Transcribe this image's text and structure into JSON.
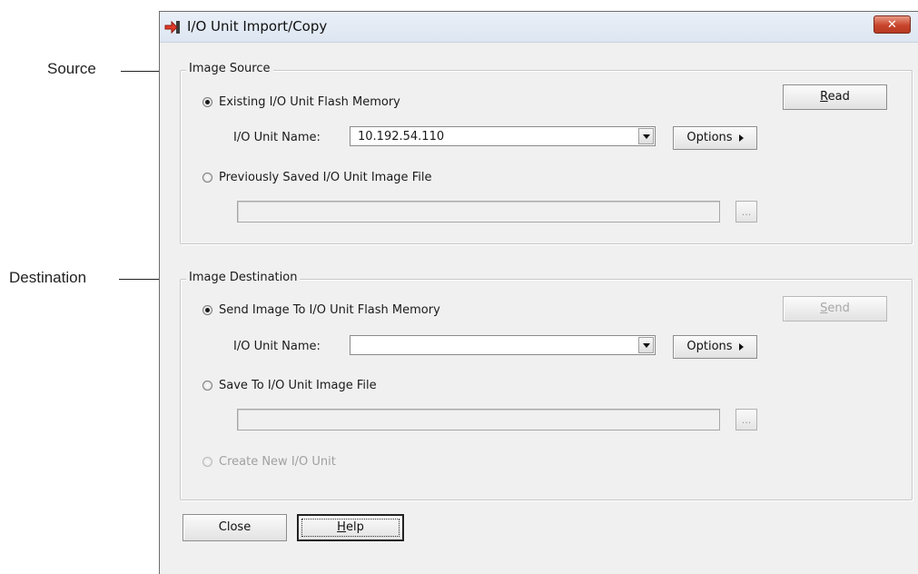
{
  "callouts": {
    "source": "Source",
    "destination": "Destination"
  },
  "window": {
    "title": "I/O Unit Import/Copy",
    "close_glyph": "✕"
  },
  "image_source": {
    "legend": "Image Source",
    "option_flash": "Existing I/O Unit Flash Memory",
    "option_flash_checked": true,
    "unit_name_label": "I/O Unit Name:",
    "unit_name_value": "10.192.54.110",
    "options_label": "Options",
    "option_file": "Previously Saved I/O Unit Image File",
    "option_file_checked": false,
    "file_path": "",
    "browse_label": "...",
    "read_label_u": "R",
    "read_label_rest": "ead"
  },
  "image_destination": {
    "legend": "Image Destination",
    "option_flash": "Send Image To I/O Unit Flash Memory",
    "option_flash_checked": true,
    "unit_name_label": "I/O Unit Name:",
    "unit_name_value": "",
    "options_label": "Options",
    "option_file": "Save To I/O Unit Image File",
    "option_file_checked": false,
    "file_path": "",
    "browse_label": "...",
    "option_new": "Create New I/O Unit",
    "option_new_enabled": false,
    "send_label_u": "S",
    "send_label_rest": "end",
    "send_enabled": false
  },
  "footer": {
    "close_label": "Close",
    "help_label_u": "H",
    "help_label_rest": "elp"
  },
  "colors": {
    "window_bg": "#f0f0f0",
    "titlebar": "#dde6f2",
    "close_red": "#c8452c"
  },
  "icons": {
    "app": "import-arrow-icon",
    "close": "close-icon",
    "dropdown": "chevron-down-icon",
    "options": "triangle-right-icon",
    "browse": "ellipsis-icon"
  }
}
